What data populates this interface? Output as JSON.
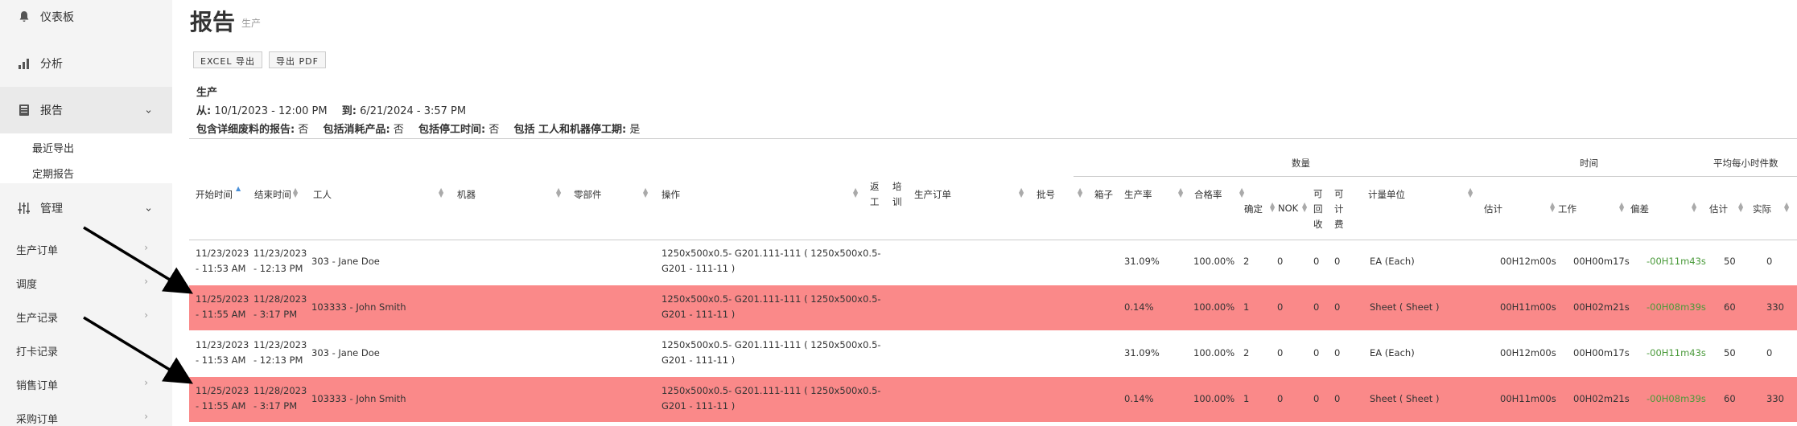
{
  "sidebar": {
    "items": [
      {
        "label": "仪表板",
        "icon": "bell-icon"
      },
      {
        "label": "分析",
        "icon": "bar-chart-icon"
      },
      {
        "label": "报告",
        "icon": "book-icon"
      },
      {
        "label": "管理",
        "icon": "sliders-icon"
      }
    ],
    "report_sub": [
      "最近导出",
      "定期报告"
    ],
    "manage_links": [
      "生产订单",
      "调度",
      "生产记录",
      "打卡记录",
      "销售订单",
      "采购订单"
    ]
  },
  "header": {
    "title": "报告",
    "subtitle": "生产"
  },
  "buttons": {
    "excel": "EXCEL 导出",
    "pdf": "导出 PDF"
  },
  "info": {
    "heading": "生产",
    "from_label": "从:",
    "from_value": "10/1/2023 - 12:00 PM",
    "to_label": "到:",
    "to_value": "6/21/2024 - 3:57 PM",
    "opt1_label": "包含详细废料的报告:",
    "opt1_value": "否",
    "opt2_label": "包括消耗产品:",
    "opt2_value": "否",
    "opt3_label": "包括停工时间:",
    "opt3_value": "否",
    "opt4_label": "包括 工人和机器停工期:",
    "opt4_value": "是"
  },
  "table": {
    "groups": {
      "quantity": "数量",
      "time": "时间",
      "avg": "平均每小时件数"
    },
    "columns": {
      "start": "开始时间",
      "end": "结束时间",
      "worker": "工人",
      "machine": "机器",
      "part": "零部件",
      "operation": "操作",
      "rework_1": "返",
      "rework_2": "工",
      "training_1": "培",
      "training_2": "训",
      "order": "生产订单",
      "batch": "批号",
      "box": "箱子",
      "rate": "生产率",
      "pass": "合格率",
      "ok": "确定",
      "nok": "NOK",
      "rec_1": "可",
      "rec_2": "回",
      "rec_3": "收",
      "bill_1": "可",
      "bill_2": "计",
      "bill_3": "费",
      "unit": "计量单位",
      "est": "估计",
      "work": "工作",
      "dev": "偏差",
      "avg_est": "估计",
      "avg_act": "实际"
    },
    "rows": [
      {
        "start1": "11/23/2023",
        "start2": "- 11:53 AM",
        "end1": "11/23/2023",
        "end2": "- 12:13 PM",
        "worker": "303 - Jane Doe",
        "op1": "1250x500x0.5- G201.111-111 ( 1250x500x0.5-",
        "op2": "G201 - 111-11 )",
        "rate": "31.09%",
        "pass": "100.00%",
        "ok": "2",
        "nok": "0",
        "rec": "0",
        "bill": "0",
        "unit": "EA (Each)",
        "est": "00H12m00s",
        "work": "00H00m17s",
        "dev": "-00H11m43s",
        "avg_est": "50",
        "avg_act": "0",
        "highlight": false
      },
      {
        "start1": "11/25/2023",
        "start2": "- 11:55 AM",
        "end1": "11/28/2023",
        "end2": "- 3:17 PM",
        "worker": "103333 - John Smith",
        "op1": "1250x500x0.5- G201.111-111 ( 1250x500x0.5-",
        "op2": "G201 - 111-11 )",
        "rate": "0.14%",
        "pass": "100.00%",
        "ok": "1",
        "nok": "0",
        "rec": "0",
        "bill": "0",
        "unit": "Sheet ( Sheet )",
        "est": "00H11m00s",
        "work": "00H02m21s",
        "dev": "-00H08m39s",
        "avg_est": "60",
        "avg_act": "330",
        "highlight": true
      },
      {
        "start1": "11/23/2023",
        "start2": "- 11:53 AM",
        "end1": "11/23/2023",
        "end2": "- 12:13 PM",
        "worker": "303 - Jane Doe",
        "op1": "1250x500x0.5- G201.111-111 ( 1250x500x0.5-",
        "op2": "G201 - 111-11 )",
        "rate": "31.09%",
        "pass": "100.00%",
        "ok": "2",
        "nok": "0",
        "rec": "0",
        "bill": "0",
        "unit": "EA (Each)",
        "est": "00H12m00s",
        "work": "00H00m17s",
        "dev": "-00H11m43s",
        "avg_est": "50",
        "avg_act": "0",
        "highlight": false
      },
      {
        "start1": "11/25/2023",
        "start2": "- 11:55 AM",
        "end1": "11/28/2023",
        "end2": "- 3:17 PM",
        "worker": "103333 - John Smith",
        "op1": "1250x500x0.5- G201.111-111 ( 1250x500x0.5-",
        "op2": "G201 - 111-11 )",
        "rate": "0.14%",
        "pass": "100.00%",
        "ok": "1",
        "nok": "0",
        "rec": "0",
        "bill": "0",
        "unit": "Sheet ( Sheet )",
        "est": "00H11m00s",
        "work": "00H02m21s",
        "dev": "-00H08m39s",
        "avg_est": "60",
        "avg_act": "330",
        "highlight": true
      }
    ]
  },
  "colors": {
    "highlight_row": "#fa8989",
    "deviation": "#4a9a3a",
    "sort_active": "#4a90d9"
  }
}
